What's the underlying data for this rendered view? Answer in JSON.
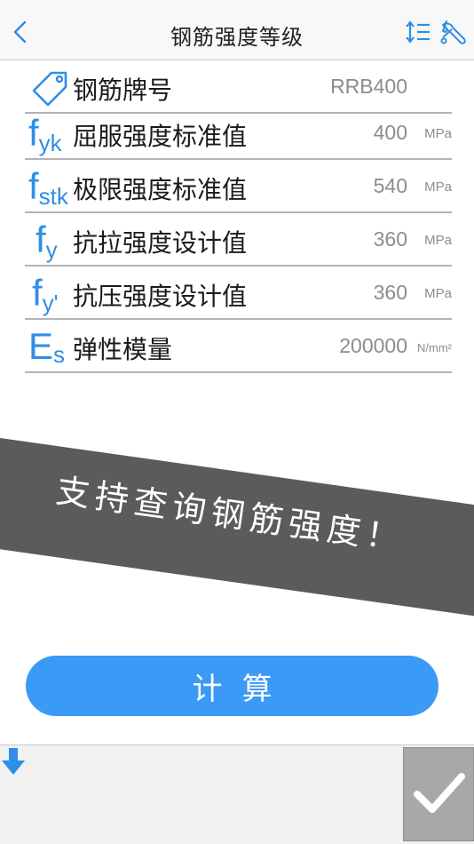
{
  "nav": {
    "title": "钢筋强度等级",
    "back_icon": "chevron-left-icon",
    "sort_icon": "sort-list-icon",
    "settings_icon": "wrench-icon"
  },
  "rows": [
    {
      "icon": "tag-icon",
      "label": "钢筋牌号",
      "value": "RRB400",
      "unit": ""
    },
    {
      "symbol_main": "f",
      "symbol_sub": "yk",
      "label": "屈服强度标准值",
      "value": "400",
      "unit": "MPa"
    },
    {
      "symbol_main": "f",
      "symbol_sub": "stk",
      "label": "极限强度标准值",
      "value": "540",
      "unit": "MPa"
    },
    {
      "symbol_main": "f",
      "symbol_sub": "y",
      "label": "抗拉强度设计值",
      "value": "360",
      "unit": "MPa"
    },
    {
      "symbol_main": "f",
      "symbol_sub": "y'",
      "label": "抗压强度设计值",
      "value": "360",
      "unit": "MPa"
    },
    {
      "symbol_main": "E",
      "symbol_sub": "s",
      "label": "弹性模量",
      "value": "200000",
      "unit": "N/mm²"
    }
  ],
  "banner": {
    "text": "支持查询钢筋强度！"
  },
  "calc_button": {
    "label": "计算"
  },
  "footer": {
    "down_icon": "arrow-down-icon",
    "confirm_icon": "checkmark-icon"
  },
  "colors": {
    "accent": "#3b9af5",
    "symbol": "#2f8ee6",
    "banner": "#5b5b5b",
    "confirm": "#a8a8a8"
  }
}
